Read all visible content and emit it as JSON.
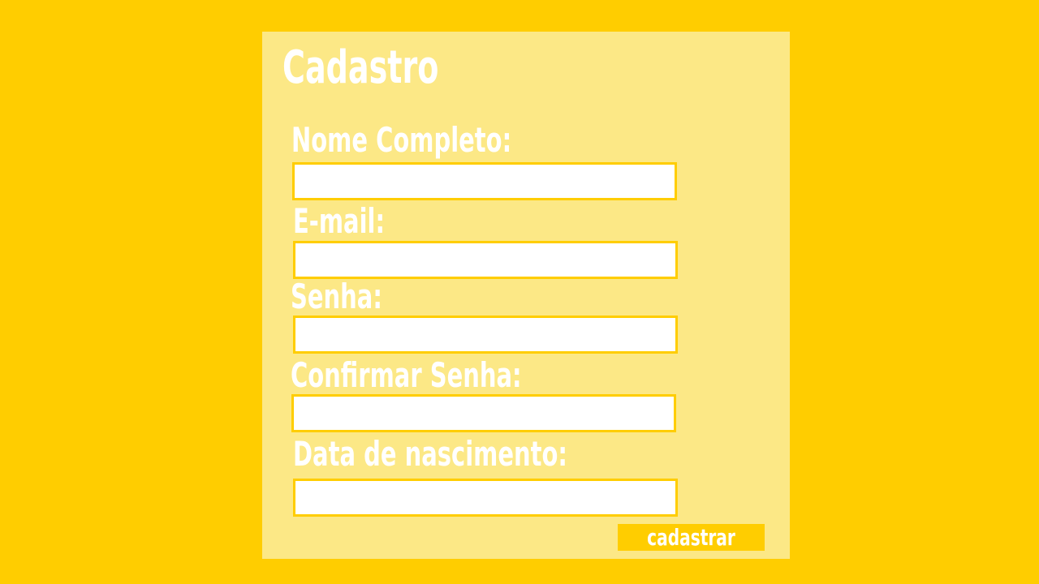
{
  "form": {
    "title": "Cadastro",
    "fields": [
      {
        "label": "Nome Completo:",
        "value": ""
      },
      {
        "label": "E-mail:",
        "value": ""
      },
      {
        "label": "Senha:",
        "value": ""
      },
      {
        "label": "Confirmar Senha:",
        "value": ""
      },
      {
        "label": "Data de nascimento:",
        "value": ""
      }
    ],
    "submit_label": "cadastrar"
  },
  "colors": {
    "background": "#FFCD00",
    "panel": "#FCE886",
    "text": "#FFFFFF",
    "field_border": "#FFCD00",
    "button": "#FFCD00"
  }
}
